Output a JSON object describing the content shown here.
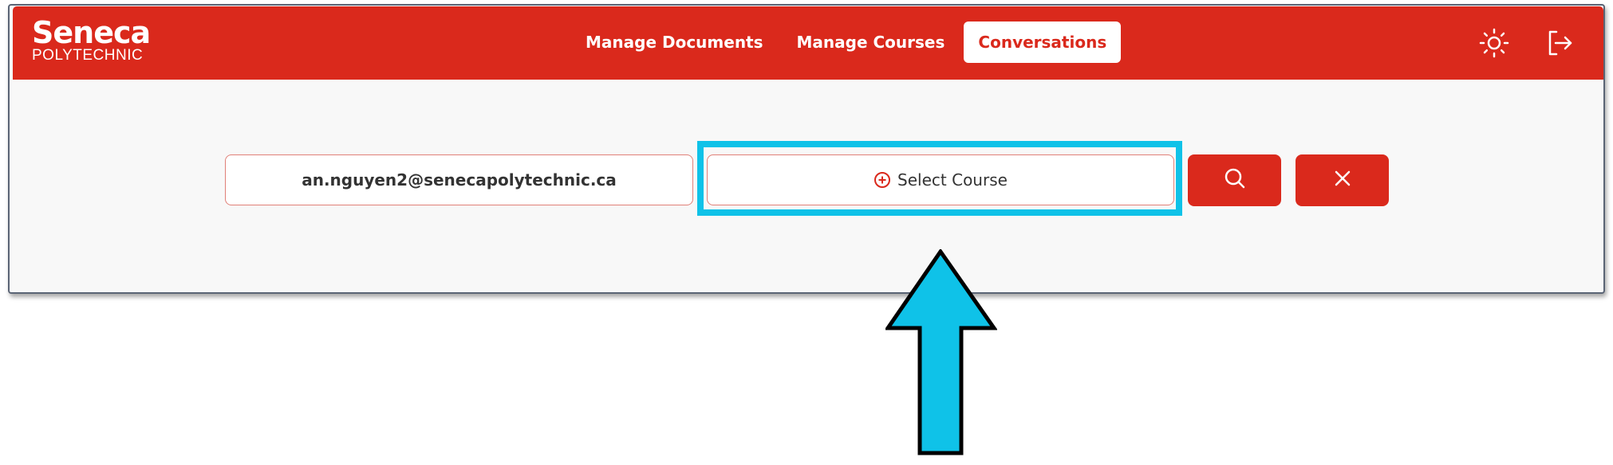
{
  "navbar": {
    "logo": {
      "main": "Seneca",
      "sub": "POLYTECHNIC"
    },
    "links": [
      {
        "label": "Manage Documents",
        "active": false
      },
      {
        "label": "Manage Courses",
        "active": false
      },
      {
        "label": "Conversations",
        "active": true
      }
    ],
    "icons": [
      "sun-icon",
      "logout-icon"
    ]
  },
  "search": {
    "email_value": "an.nguyen2@senecapolytechnic.ca",
    "course_placeholder": "Select Course",
    "course_icon": "plus-circle-icon",
    "search_icon": "search-icon",
    "clear_icon": "close-icon"
  },
  "annotation": {
    "highlight_color": "#0fc2e8",
    "arrow_color": "#0fc2e8"
  },
  "colors": {
    "brand_red": "#da291c",
    "background": "#f8f8f8"
  }
}
